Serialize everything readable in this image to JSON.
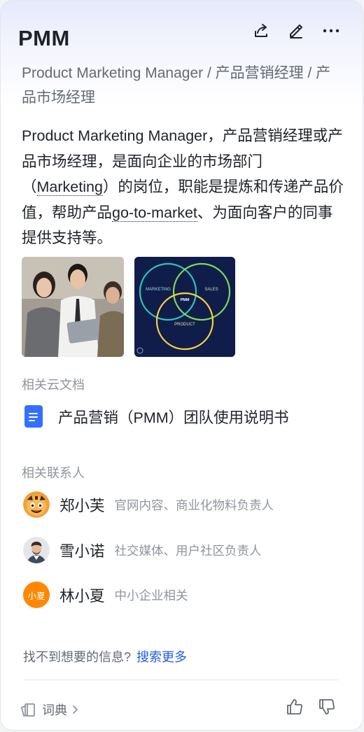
{
  "header": {
    "title": "PMM",
    "actions": [
      {
        "icon": "share-icon"
      },
      {
        "icon": "edit-icon"
      },
      {
        "icon": "more-icon"
      }
    ]
  },
  "subtitle": "Product Marketing Manager / 产品营销经理 / 产品市场经理",
  "description": {
    "part1": "Product Marketing Manager，产品营销经理或产品市场经理，是面向企业的市场部门（",
    "kw1": "Marketing",
    "part2": "）的岗位，职能是提炼和传递产品价值，帮助产品",
    "kw2": "go-to-market",
    "part3": "、为面向客户的同事提供支持等。"
  },
  "images": {
    "venn": {
      "marketing": "MARKETING",
      "sales": "SALES",
      "product": "PRODUCT",
      "center": "PMM"
    }
  },
  "docs": {
    "label": "相关云文档",
    "items": [
      {
        "title": "产品营销（PMM）团队使用说明书",
        "icon": "doc-icon"
      }
    ]
  },
  "contacts": {
    "label": "相关联系人",
    "items": [
      {
        "name": "郑小芙",
        "role": "官网内容、商业化物料负责人"
      },
      {
        "name": "雪小诺",
        "role": "社交媒体、用户社区负责人"
      },
      {
        "name": "林小夏",
        "role": "中小企业相关",
        "avatar_text": "小夏"
      }
    ]
  },
  "footer": {
    "not_found": "找不到想要的信息?",
    "search_more": "搜索更多",
    "dictionary": "词典",
    "colors": {
      "link": "#245bdb",
      "doc": "#3370ff",
      "avatar_orange": "#ff8800"
    }
  }
}
